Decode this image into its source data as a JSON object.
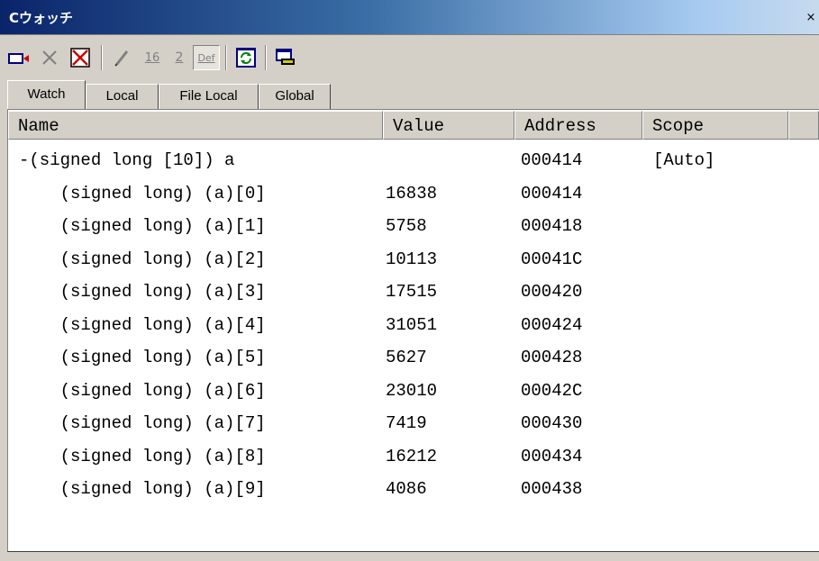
{
  "window": {
    "title": "Cウォッチ",
    "close_glyph": "×"
  },
  "toolbar": {
    "buttons": [
      {
        "name": "add-watch-icon"
      },
      {
        "name": "delete-icon"
      },
      {
        "name": "delete-all-icon"
      },
      {
        "name": "edit-value-icon"
      },
      {
        "name": "hex-radix-icon",
        "label": "16"
      },
      {
        "name": "binary-radix-icon",
        "label": "2"
      },
      {
        "name": "default-radix-icon",
        "label": "Def"
      },
      {
        "name": "refresh-icon"
      },
      {
        "name": "output-icon"
      }
    ]
  },
  "tabs": [
    {
      "label": "Watch",
      "active": true
    },
    {
      "label": "Local"
    },
    {
      "label": "File Local"
    },
    {
      "label": "Global"
    }
  ],
  "table": {
    "columns": [
      "Name",
      "Value",
      "Address",
      "Scope"
    ],
    "rows": [
      {
        "name": "-(signed long [10]) a",
        "value": "",
        "address": "000414",
        "scope": "[Auto]"
      },
      {
        "name": "    (signed long) (a)[0]",
        "value": "16838",
        "address": "000414",
        "scope": ""
      },
      {
        "name": "    (signed long) (a)[1]",
        "value": "5758",
        "address": "000418",
        "scope": ""
      },
      {
        "name": "    (signed long) (a)[2]",
        "value": "10113",
        "address": "00041C",
        "scope": ""
      },
      {
        "name": "    (signed long) (a)[3]",
        "value": "17515",
        "address": "000420",
        "scope": ""
      },
      {
        "name": "    (signed long) (a)[4]",
        "value": "31051",
        "address": "000424",
        "scope": ""
      },
      {
        "name": "    (signed long) (a)[5]",
        "value": "5627",
        "address": "000428",
        "scope": ""
      },
      {
        "name": "    (signed long) (a)[6]",
        "value": "23010",
        "address": "00042C",
        "scope": ""
      },
      {
        "name": "    (signed long) (a)[7]",
        "value": "7419",
        "address": "000430",
        "scope": ""
      },
      {
        "name": "    (signed long) (a)[8]",
        "value": "16212",
        "address": "000434",
        "scope": ""
      },
      {
        "name": "    (signed long) (a)[9]",
        "value": "4086",
        "address": "000438",
        "scope": ""
      }
    ]
  }
}
